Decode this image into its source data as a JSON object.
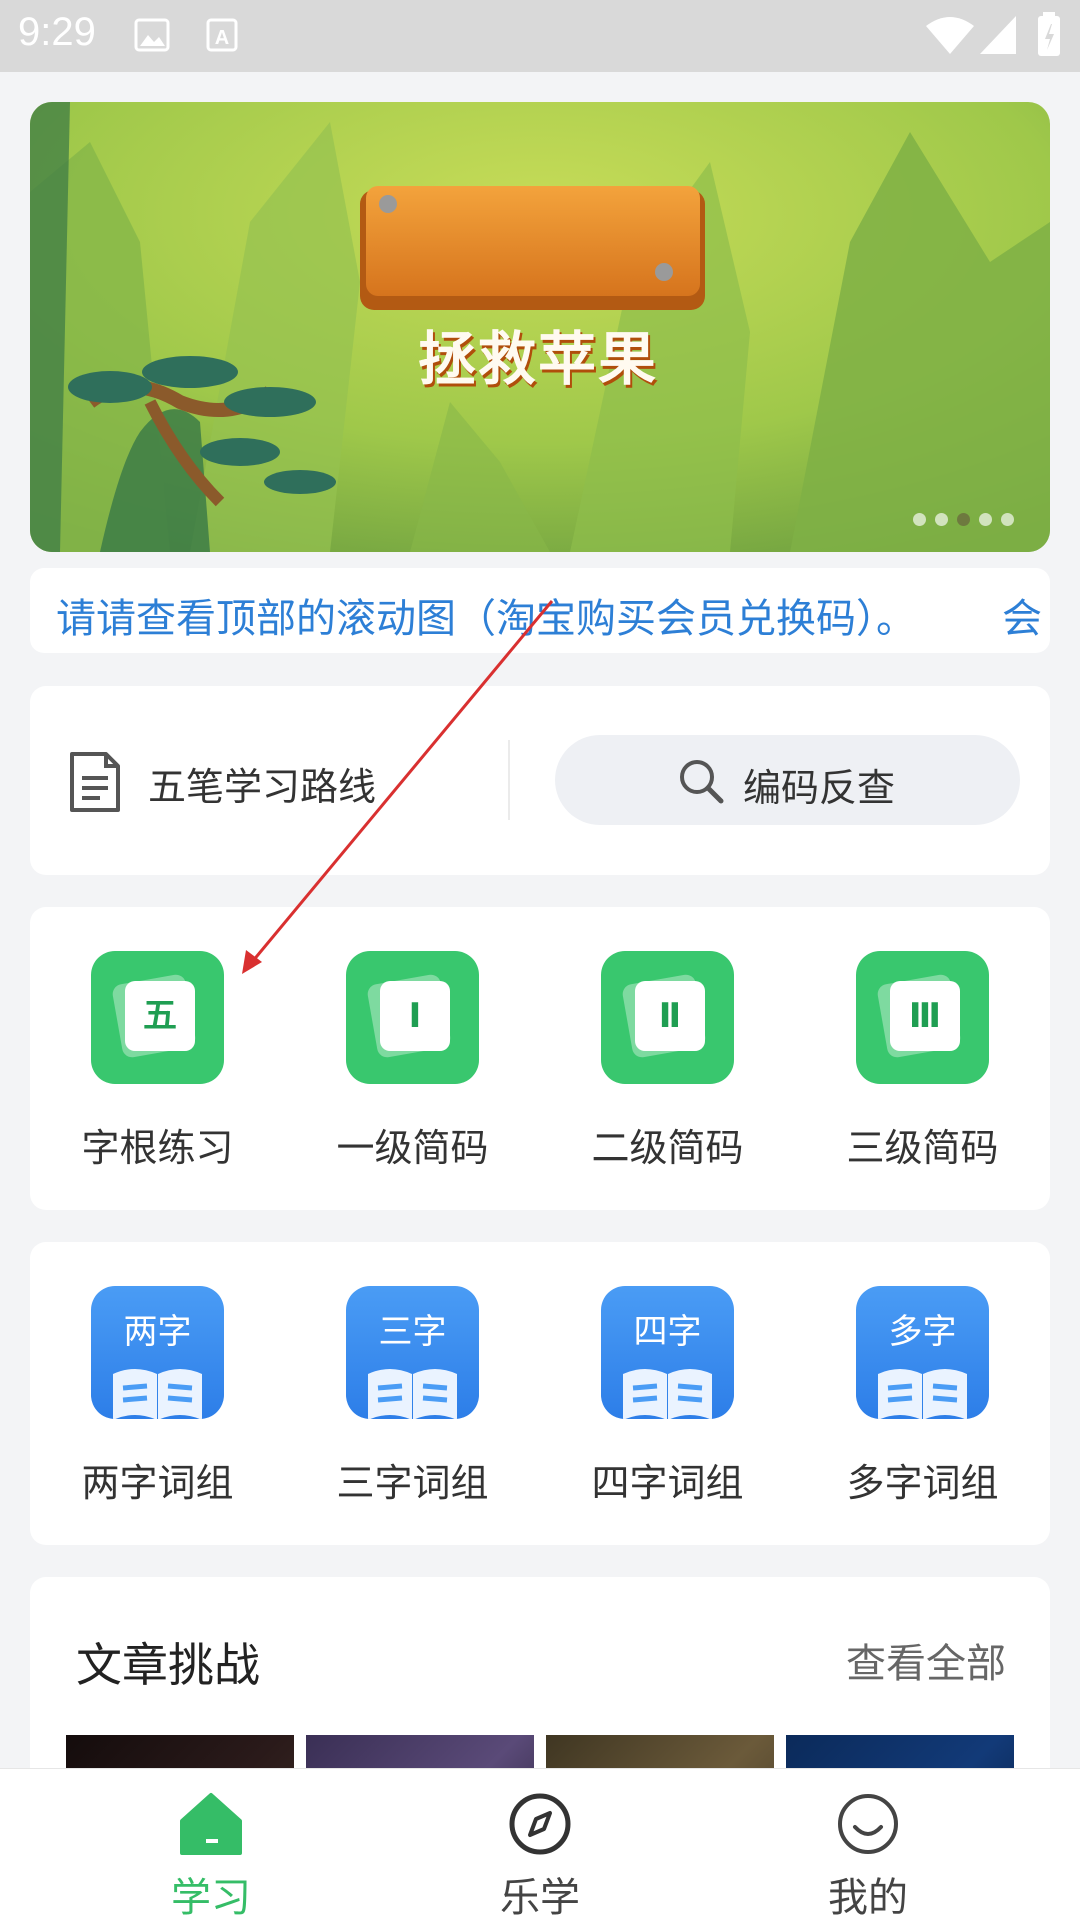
{
  "status_bar": {
    "time": "9:29"
  },
  "banner": {
    "title": "拯救苹果",
    "page_count": 5,
    "active_page": 3
  },
  "notice": {
    "text": "请请查看顶部的滚动图（淘宝购买会员兑换码）。",
    "text_continued": "会"
  },
  "route": {
    "label": "五笔学习路线",
    "search_label": "编码反查"
  },
  "basic_grid": [
    {
      "glyph": "五",
      "label": "字根练习"
    },
    {
      "glyph": "Ⅰ",
      "label": "一级简码"
    },
    {
      "glyph": "Ⅱ",
      "label": "二级简码"
    },
    {
      "glyph": "Ⅲ",
      "label": "三级简码"
    }
  ],
  "phrase_grid": [
    {
      "glyph": "两字",
      "label": "两字词组"
    },
    {
      "glyph": "三字",
      "label": "三字词组"
    },
    {
      "glyph": "四字",
      "label": "四字词组"
    },
    {
      "glyph": "多字",
      "label": "多字词组"
    }
  ],
  "articles": {
    "title": "文章挑战",
    "more_label": "查看全部"
  },
  "tabbar": [
    {
      "label": "学习",
      "icon": "home-icon",
      "active": true
    },
    {
      "label": "乐学",
      "icon": "compass-icon",
      "active": false
    },
    {
      "label": "我的",
      "icon": "smile-icon",
      "active": false
    }
  ],
  "colors": {
    "accent_green": "#35bd67",
    "accent_blue": "#2d7fd6",
    "annotation_red": "#d93030"
  }
}
